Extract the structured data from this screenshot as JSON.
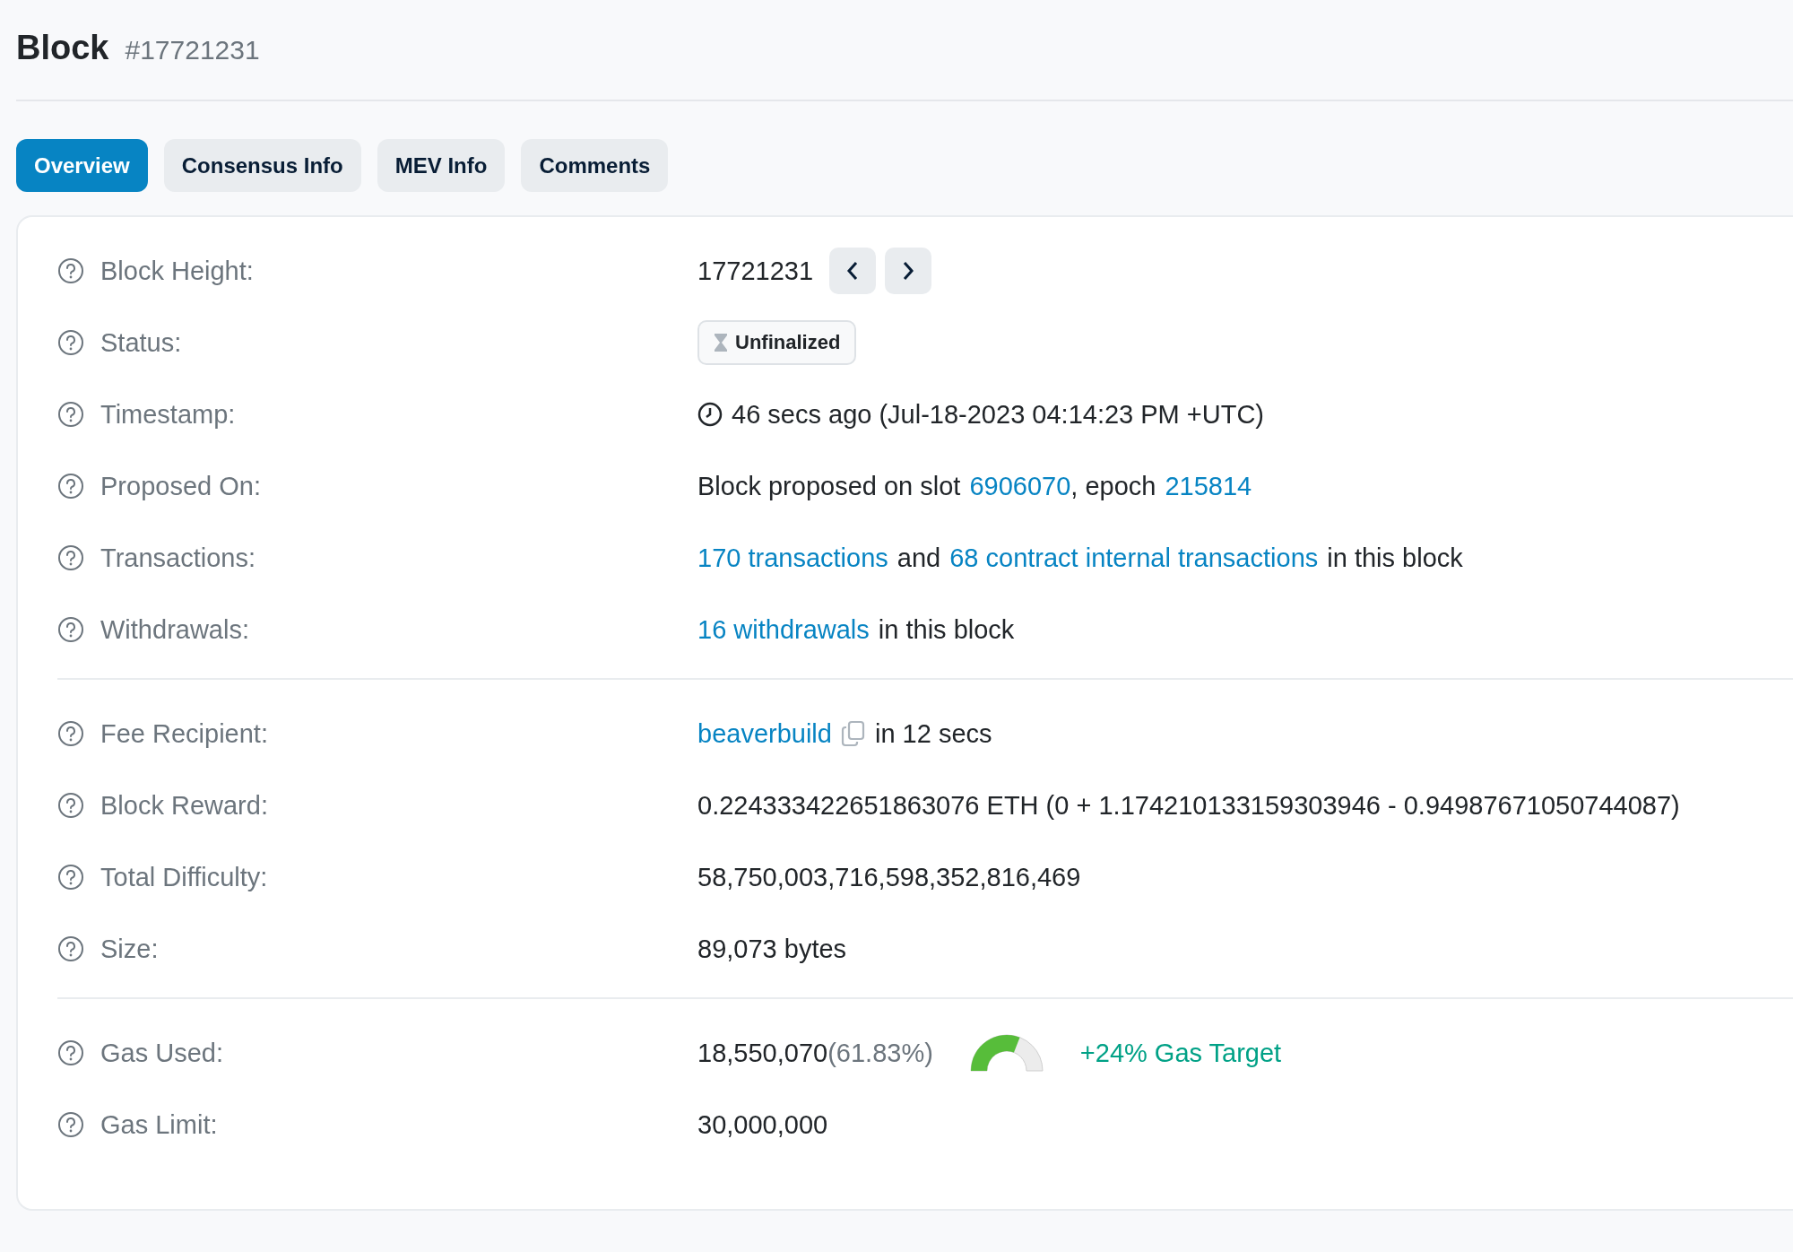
{
  "header": {
    "title": "Block",
    "number": "#17721231"
  },
  "tabs": [
    {
      "label": "Overview",
      "selected": true
    },
    {
      "label": "Consensus Info",
      "selected": false
    },
    {
      "label": "MEV Info",
      "selected": false
    },
    {
      "label": "Comments",
      "selected": false
    }
  ],
  "sections": [
    {
      "rows": [
        {
          "label": "Block Height:",
          "kind": "height",
          "value": "17721231"
        },
        {
          "label": "Status:",
          "kind": "badge",
          "value": "Unfinalized"
        },
        {
          "label": "Timestamp:",
          "kind": "time",
          "value": "46 secs ago (Jul-18-2023 04:14:23 PM +UTC)"
        },
        {
          "label": "Proposed On:",
          "kind": "segments",
          "segments": [
            {
              "kind": "text",
              "text": "Block proposed on slot"
            },
            {
              "kind": "link",
              "text": "6906070"
            },
            {
              "kind": "text",
              "text": ", epoch"
            },
            {
              "kind": "link",
              "text": "215814"
            }
          ]
        },
        {
          "label": "Transactions:",
          "kind": "segments",
          "segments": [
            {
              "kind": "link",
              "text": "170 transactions"
            },
            {
              "kind": "text",
              "text": "and"
            },
            {
              "kind": "link",
              "text": "68 contract internal transactions"
            },
            {
              "kind": "text",
              "text": "in this block"
            }
          ]
        },
        {
          "label": "Withdrawals:",
          "kind": "segments",
          "segments": [
            {
              "kind": "link",
              "text": "16 withdrawals"
            },
            {
              "kind": "text",
              "text": "in this block"
            }
          ]
        }
      ]
    },
    {
      "rows": [
        {
          "label": "Fee Recipient:",
          "kind": "segments",
          "segments": [
            {
              "kind": "link",
              "text": "beaverbuild"
            },
            {
              "kind": "copy"
            },
            {
              "kind": "text",
              "text": "in 12 secs"
            }
          ]
        },
        {
          "label": "Block Reward:",
          "kind": "plain",
          "value": "0.224333422651863076 ETH (0 + 1.174210133159303946 - 0.94987671050744087)"
        },
        {
          "label": "Total Difficulty:",
          "kind": "plain",
          "value": "58,750,003,716,598,352,816,469"
        },
        {
          "label": "Size:",
          "kind": "plain",
          "value": "89,073 bytes"
        }
      ]
    },
    {
      "rows": [
        {
          "label": "Gas Used:",
          "kind": "gauge",
          "value": "18,550,070",
          "percent": "(61.83%)",
          "level": 0.6183,
          "target": "+24% Gas Target"
        },
        {
          "label": "Gas Limit:",
          "kind": "plain",
          "value": "30,000,000"
        }
      ]
    }
  ]
}
